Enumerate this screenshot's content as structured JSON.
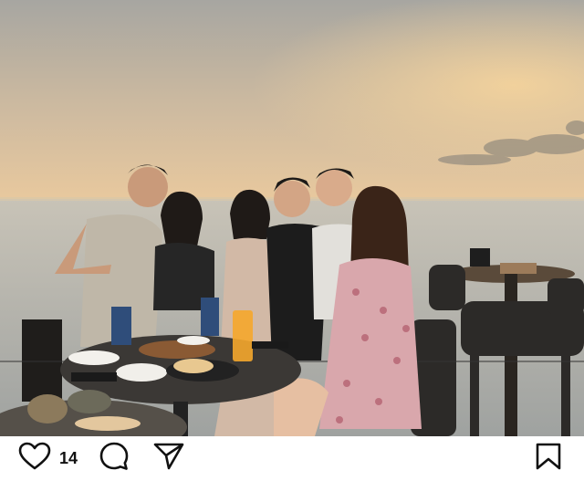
{
  "post": {
    "image_alt": "",
    "image_description": ""
  },
  "actions": {
    "like_count": "14",
    "icons": {
      "like": "heart-outline-icon",
      "comment": "comment-bubble-icon",
      "share": "paper-plane-icon",
      "save": "bookmark-icon"
    }
  },
  "colors": {
    "sky_top": "#a9a7a0",
    "sky_glow": "#e8c79a",
    "sea": "#b9b9b3",
    "icon": "#111111"
  }
}
